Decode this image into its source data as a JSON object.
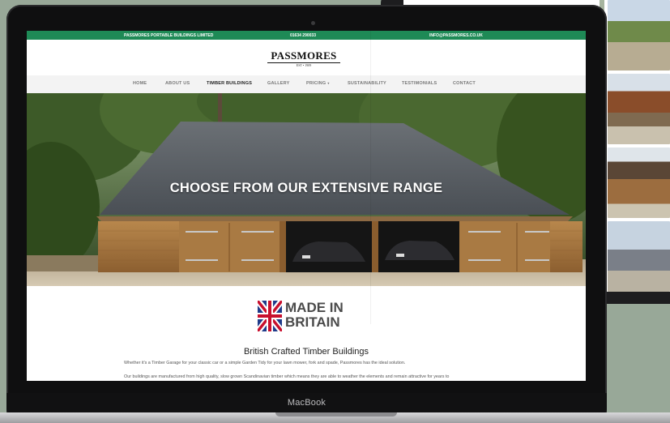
{
  "device": {
    "laptop_brand": "MacBook"
  },
  "site": {
    "topbar": {
      "company": "PASSMORES PORTABLE BUILDINGS LIMITED",
      "phone": "01634 290033",
      "email": "INFO@PASSMORES.CO.UK"
    },
    "logo": {
      "name": "PASSMORES",
      "est": "EST • 1909"
    },
    "nav": {
      "items": [
        {
          "label": "HOME"
        },
        {
          "label": "ABOUT US"
        },
        {
          "label": "TIMBER BUILDINGS"
        },
        {
          "label": "GALLERY"
        },
        {
          "label": "PRICING"
        },
        {
          "label": "SUSTAINABILITY"
        },
        {
          "label": "TESTIMONIALS"
        },
        {
          "label": "CONTACT"
        }
      ],
      "active": "TIMBER BUILDINGS"
    },
    "hero": {
      "headline": "CHOOSE FROM OUR EXTENSIVE RANGE"
    },
    "badge": {
      "line1": "MADE IN",
      "line2": "BRITAIN"
    },
    "intro": {
      "title": "British Crafted Timber Buildings",
      "paragraph1": "Whether it's a Timber Garage for your classic car or a simple Garden Tidy for your lawn mower, fork and spade, Passmores has the ideal solution.",
      "paragraph2": "Our buildings are manufactured from high quality, slow grown Scandinavian timber which means they are able to weather the elements and remain attractive for years to"
    }
  },
  "colors": {
    "brand_green": "#1e8a56",
    "nav_bg": "#f3f3f3"
  }
}
